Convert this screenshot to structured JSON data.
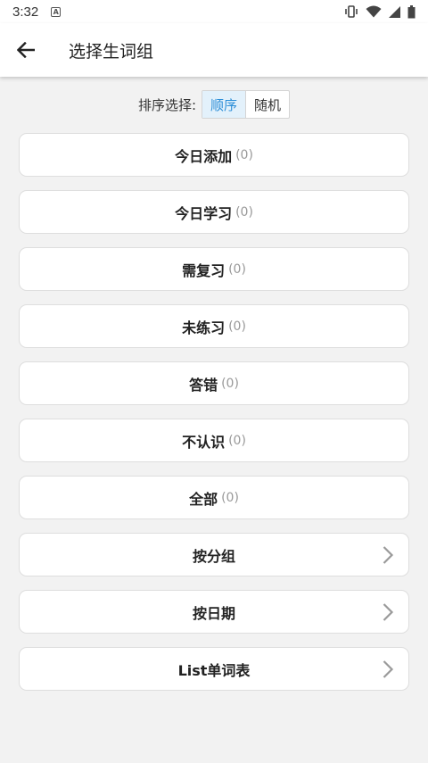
{
  "status_bar": {
    "time": "3:32",
    "notification_icon": "a-letter-icon",
    "icons": [
      "vibrate-icon",
      "wifi-icon",
      "signal-icon",
      "battery-icon"
    ]
  },
  "app_bar": {
    "back_icon": "arrow-left-icon",
    "title": "选择生词组"
  },
  "sort": {
    "label": "排序选择:",
    "options": [
      "顺序",
      "随机"
    ],
    "selected": "顺序"
  },
  "groups": [
    {
      "label": "今日添加",
      "count": "(0)"
    },
    {
      "label": "今日学习",
      "count": "(0)"
    },
    {
      "label": "需复习",
      "count": "(0)"
    },
    {
      "label": "未练习",
      "count": "(0)"
    },
    {
      "label": "答错",
      "count": "(0)"
    },
    {
      "label": "不认识",
      "count": "(0)"
    },
    {
      "label": "全部",
      "count": "(0)"
    },
    {
      "label": "按分组",
      "count": ""
    },
    {
      "label": "按日期",
      "count": ""
    },
    {
      "label": "List单词表",
      "count": ""
    }
  ],
  "colors": {
    "accent": "#2d8fd8",
    "selected_bg": "#e3f1fb",
    "background": "#f2f2f2"
  }
}
